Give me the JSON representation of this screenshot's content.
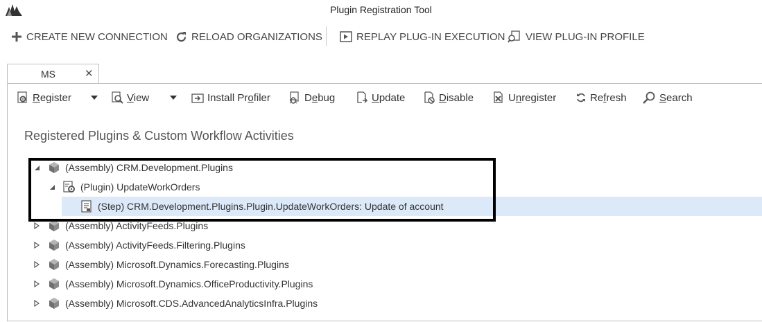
{
  "window": {
    "title": "Plugin Registration Tool",
    "logo_icon": "dynamics-logo-icon"
  },
  "mainbar": {
    "create": "CREATE NEW CONNECTION",
    "reload": "RELOAD ORGANIZATIONS",
    "replay": "REPLAY PLUG-IN EXECUTION",
    "profile": "VIEW PLUG-IN PROFILE"
  },
  "tab": {
    "label": "MS",
    "close": "✕"
  },
  "toolbar": {
    "register_pre": "",
    "register_u": "R",
    "register_post": "egister",
    "view_pre": "",
    "view_u": "V",
    "view_post": "iew",
    "install_pre": "Install Pr",
    "install_u": "o",
    "install_post": "filer",
    "debug_pre": "D",
    "debug_u": "e",
    "debug_post": "bug",
    "update_pre": "",
    "update_u": "U",
    "update_post": "pdate",
    "disable_pre": "",
    "disable_u": "D",
    "disable_post": "isable",
    "unregister_pre": "U",
    "unregister_u": "n",
    "unregister_post": "register",
    "refresh_pre": "Re",
    "refresh_u": "f",
    "refresh_post": "resh",
    "search_pre": "",
    "search_u": "S",
    "search_post": "earch"
  },
  "section_title": "Registered Plugins & Custom Workflow Activities",
  "tree": [
    {
      "label": "(Assembly) CRM.Development.Plugins",
      "type": "assembly",
      "expanded": true,
      "level": 0
    },
    {
      "label": "(Plugin) UpdateWorkOrders",
      "type": "plugin",
      "expanded": true,
      "level": 1
    },
    {
      "label": "(Step) CRM.Development.Plugins.Plugin.UpdateWorkOrders: Update of account",
      "type": "step",
      "selected": true,
      "level": 2
    },
    {
      "label": "(Assembly) ActivityFeeds.Plugins",
      "type": "assembly",
      "expanded": false,
      "level": 0
    },
    {
      "label": "(Assembly) ActivityFeeds.Filtering.Plugins",
      "type": "assembly",
      "expanded": false,
      "level": 0
    },
    {
      "label": "(Assembly) Microsoft.Dynamics.Forecasting.Plugins",
      "type": "assembly",
      "expanded": false,
      "level": 0
    },
    {
      "label": "(Assembly) Microsoft.Dynamics.OfficeProductivity.Plugins",
      "type": "assembly",
      "expanded": false,
      "level": 0
    },
    {
      "label": "(Assembly) Microsoft.CDS.AdvancedAnalyticsInfra.Plugins",
      "type": "assembly",
      "expanded": false,
      "level": 0
    }
  ],
  "colors": {
    "selection": "#dce9f8",
    "highlight_border": "#000000"
  }
}
